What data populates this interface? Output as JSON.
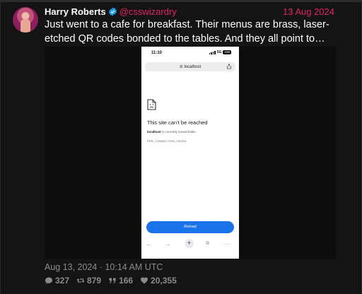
{
  "author": {
    "name": "Harry Roberts",
    "handle": "@csswizardry",
    "date": "13 Aug 2024"
  },
  "tweet_text": "Just went to a cafe for breakfast. Their menus are brass, laser-etched QR codes bonded to the tables. And they all point to…",
  "phone": {
    "time": "11:10",
    "network": "5G",
    "battery": "100",
    "url": "localhost",
    "error_title": "This site can’t be reached",
    "error_host": "localhost",
    "error_message": " is currently unreachable.",
    "error_code": "ERR_CONNECTION_FAILED",
    "reload_label": "Reload",
    "nav_icons": [
      "back-icon",
      "forward-icon",
      "new-tab-icon",
      "tabs-icon",
      "more-icon"
    ]
  },
  "timestamp": "Aug 13, 2024 · 10:14 AM UTC",
  "stats": {
    "replies": "327",
    "retweets": "879",
    "quotes": "166",
    "likes": "20,355"
  },
  "colors": {
    "background": "#141414",
    "accent": "#e0245e",
    "verified": "#1d9bf0",
    "reload_button": "#1a73e8"
  }
}
